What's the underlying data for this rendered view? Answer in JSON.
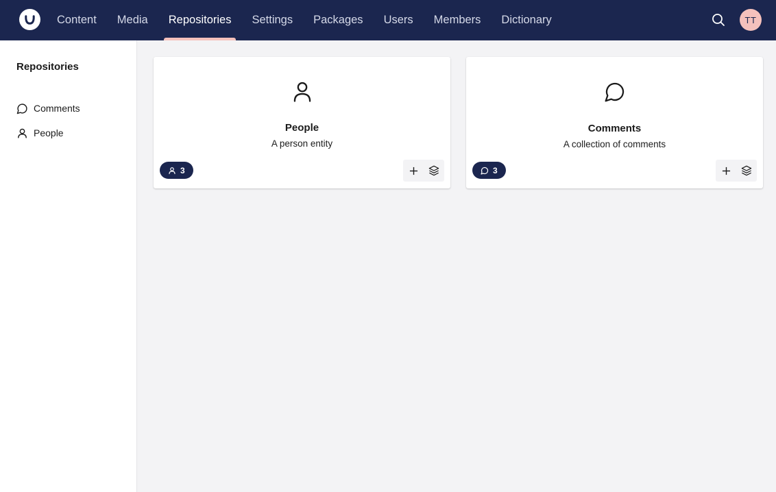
{
  "header": {
    "logo_icon": "umbraco-logo-icon",
    "nav": [
      {
        "label": "Content"
      },
      {
        "label": "Media"
      },
      {
        "label": "Repositories",
        "active": true
      },
      {
        "label": "Settings"
      },
      {
        "label": "Packages"
      },
      {
        "label": "Users"
      },
      {
        "label": "Members"
      },
      {
        "label": "Dictionary"
      }
    ],
    "search_icon": "search-icon",
    "avatar_initials": "TT"
  },
  "sidebar": {
    "title": "Repositories",
    "items": [
      {
        "label": "Comments",
        "icon": "chat-bubble-icon"
      },
      {
        "label": "People",
        "icon": "user-icon"
      }
    ]
  },
  "cards": [
    {
      "title": "People",
      "description": "A person entity",
      "icon": "user-icon",
      "count": "3"
    },
    {
      "title": "Comments",
      "description": "A collection of comments",
      "icon": "chat-bubble-icon",
      "count": "3"
    }
  ],
  "colors": {
    "header_bg": "#1b264f",
    "accent": "#f5c1bc",
    "page_bg": "#f3f3f5"
  }
}
